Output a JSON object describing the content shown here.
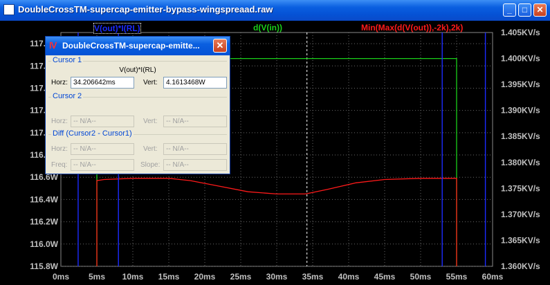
{
  "window": {
    "title": "DoubleCrossTM-supercap-emitter-bypass-wingspreaad.raw",
    "min_label": "_",
    "max_label": "□",
    "close_label": "✕"
  },
  "traces": {
    "power_label": "V(out)*I(RL)",
    "dvin_label": "d(V(in))",
    "minmax_label": "Min(Max(d(V(out)),-2k),2k)",
    "power_color": "#1c2bff",
    "dvin_color": "#1ad01a",
    "minmax_color": "#ff1a1a"
  },
  "chart_data": {
    "type": "line",
    "x_ticks": [
      "0ms",
      "5ms",
      "10ms",
      "15ms",
      "20ms",
      "25ms",
      "30ms",
      "35ms",
      "40ms",
      "45ms",
      "50ms",
      "55ms",
      "60ms"
    ],
    "y_left_ticks": [
      "117.8W",
      "117.6W",
      "117.4W",
      "117.2W",
      "117.0W",
      "116.8W",
      "116.6W",
      "116.4W",
      "116.2W",
      "116.0W",
      "115.8W"
    ],
    "y_right_ticks": [
      "1.405KV/s",
      "1.400KV/s",
      "1.395KV/s",
      "1.390KV/s",
      "1.385KV/s",
      "1.380KV/s",
      "1.375KV/s",
      "1.370KV/s",
      "1.365KV/s",
      "1.360KV/s"
    ],
    "x_range_ms": [
      0,
      60
    ],
    "y_left_range_W": [
      115.8,
      117.9
    ],
    "y_right_range_KVs": [
      1.36,
      1.405
    ],
    "cursor_x_ms": 34.2,
    "series": [
      {
        "name": "d(V(in))",
        "axis": "right",
        "x_ms": [
          5.0,
          5.0,
          55.0,
          55.0
        ],
        "y": [
          1.36,
          1.4,
          1.4,
          1.36
        ]
      },
      {
        "name": "Min(Max(d(V(out)),-2k),2k)",
        "axis": "left",
        "x_ms": [
          5.0,
          5.0,
          6.0,
          10.0,
          15.0,
          18.0,
          22.0,
          26.0,
          30.0,
          34.0,
          37.0,
          41.0,
          45.0,
          50.0,
          54.5,
          55.0,
          55.0
        ],
        "y": [
          115.8,
          116.57,
          116.58,
          116.59,
          116.59,
          116.57,
          116.52,
          116.47,
          116.45,
          116.45,
          116.49,
          116.55,
          116.58,
          116.59,
          116.59,
          116.59,
          115.8
        ]
      },
      {
        "name": "V(out)*I(RL)",
        "axis": "left",
        "spikes_ms": [
          2.4,
          8.0,
          53.0,
          59.0
        ]
      }
    ]
  },
  "cursor_dialog": {
    "title": "DoubleCrossTM-supercap-emitte...",
    "close_label": "✕",
    "cursor1_label": "Cursor 1",
    "cursor1_trace": "V(out)*I(RL)",
    "horz_label": "Horz:",
    "vert_label": "Vert:",
    "cursor1_horz": "34.206642ms",
    "cursor1_vert": "4.1613468W",
    "cursor2_label": "Cursor 2",
    "na": "-- N/A--",
    "diff_label": "Diff (Cursor2 - Cursor1)",
    "freq_label": "Freq:",
    "slope_label": "Slope:"
  }
}
